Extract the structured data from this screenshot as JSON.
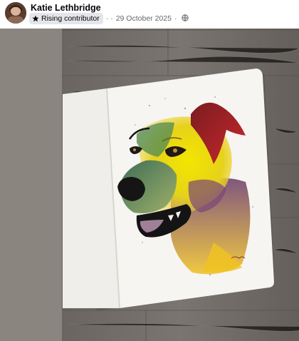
{
  "post": {
    "author_name": "Katie Lethbridge",
    "badge_label": "Rising contributor",
    "badge_icon": "star-icon",
    "separator": "·",
    "date": "29 October 2025",
    "privacy_icon": "globe-icon"
  },
  "colors": {
    "background_panel": "#8a857f",
    "wood": "#6f6a64",
    "paper": "#f6f5f2",
    "text_primary": "#050505",
    "text_secondary": "#65676b",
    "badge_bg": "#e4e6eb"
  }
}
